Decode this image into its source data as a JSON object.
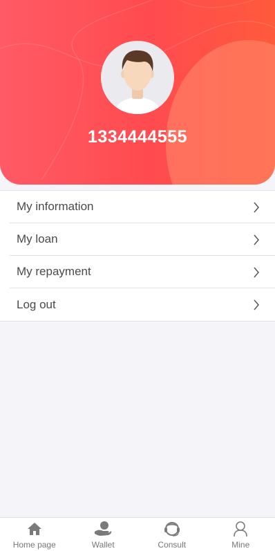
{
  "profile": {
    "phone": "1334444555"
  },
  "menu": {
    "items": [
      {
        "label": "My information"
      },
      {
        "label": "My loan"
      },
      {
        "label": "My repayment"
      },
      {
        "label": "Log out"
      }
    ]
  },
  "tabbar": {
    "items": [
      {
        "label": "Home page",
        "icon": "home-icon"
      },
      {
        "label": "Wallet",
        "icon": "wallet-icon"
      },
      {
        "label": "Consult",
        "icon": "consult-icon"
      },
      {
        "label": "Mine",
        "icon": "user-icon"
      }
    ]
  },
  "colors": {
    "header_start": "#ff5a66",
    "header_end": "#ff5a3c",
    "text": "#4a4a4a",
    "tab_icon": "#7a7a7a",
    "background": "#f5f4f8"
  }
}
